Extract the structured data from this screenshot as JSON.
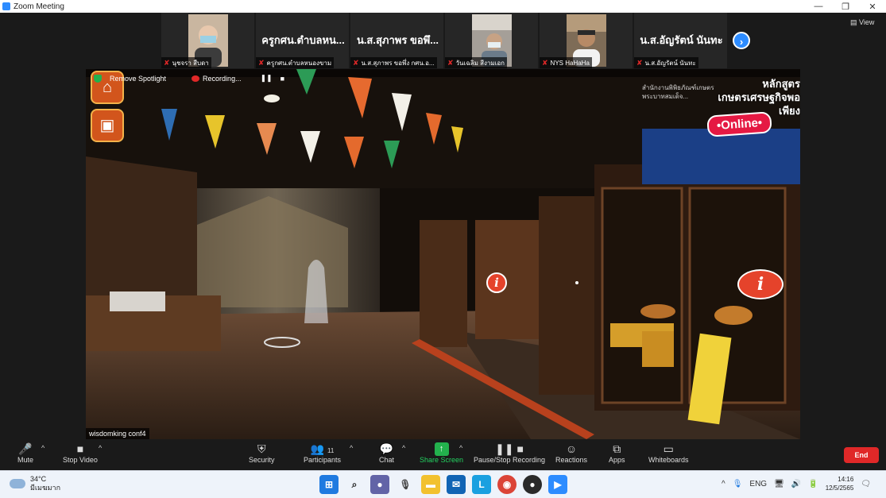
{
  "window": {
    "title": "Zoom Meeting",
    "controls": [
      "—",
      "❐",
      "✕"
    ]
  },
  "gallery": {
    "tiles": [
      {
        "display": "",
        "label": "นุชจรา สืบดา",
        "has_video": true,
        "cam_color": "#c9a98e"
      },
      {
        "display": "ครูกศน.ตำบลหน...",
        "label": "ครูกศน.ตำบลหนองขาม",
        "has_video": false
      },
      {
        "display": "น.ส.สุภาพร ขอพึ...",
        "label": "น.ส.สุภาพร ขอพึ่ง กศน.อ...",
        "has_video": false
      },
      {
        "display": "",
        "label": "วันเฉลิม สีงามเอก",
        "has_video": true,
        "cam_color": "#8e8a86"
      },
      {
        "display": "",
        "label": "NYS HaHaHa",
        "has_video": true,
        "cam_color": "#8b7860"
      },
      {
        "display": "น.ส.อัญรัตน์ นันทะ",
        "label": "น.ส.อัญรัตน์ นันทะ",
        "has_video": false
      }
    ],
    "next_icon": "›",
    "view_label": "View"
  },
  "stage": {
    "remove_spotlight": "Remove Spotlight",
    "recording": "Recording...",
    "pause_icon": "❚❚",
    "stop_icon": "■",
    "participant_label": "wisdomking conf4",
    "online_badge": "•Online•",
    "brand_small": "สำนักงานพิพิธภัณฑ์เกษตร\nพระบาทสมเด็จ...",
    "brand_course": "หลักสูตร\nเกษตรเศรษฐกิจพอเพียง",
    "info_icon": "i",
    "home_icon": "⌂",
    "gallery_icon": "▣"
  },
  "toolbar": {
    "mute": "Mute",
    "stop_video": "Stop Video",
    "security": "Security",
    "participants": "Participants",
    "participants_count": "11",
    "chat": "Chat",
    "share_screen": "Share Screen",
    "pause_stop_recording": "Pause/Stop Recording",
    "reactions": "Reactions",
    "apps": "Apps",
    "whiteboards": "Whiteboards",
    "end": "End",
    "caret": "^"
  },
  "taskbar": {
    "temperature": "34°C",
    "weather_text": "มีเมฆมาก",
    "language": "ENG",
    "time": "14:16",
    "date": "12/5/2565",
    "chevron": "^"
  },
  "colors": {
    "zoom_blue": "#2d8cff",
    "share_green": "#23b14d",
    "end_red": "#e02828",
    "online_pink": "#e51943"
  }
}
